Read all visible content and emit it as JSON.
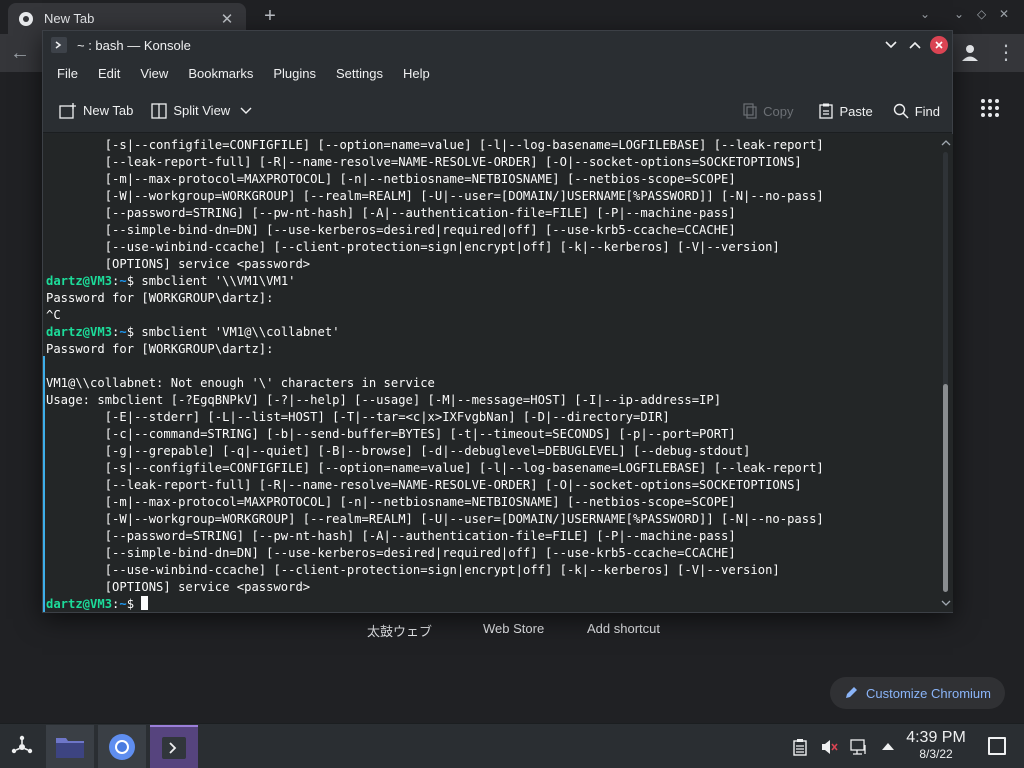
{
  "browser": {
    "tab_title": "New Tab",
    "tab_close": "✕",
    "new_tab": "+",
    "shortcuts": [
      "太鼓ウェブ",
      "Web Store",
      "Add shortcut"
    ],
    "customize_label": "Customize Chromium",
    "accent": "#8ab4f8"
  },
  "konsole": {
    "title": "~ : bash — Konsole",
    "menu": [
      "File",
      "Edit",
      "View",
      "Bookmarks",
      "Plugins",
      "Settings",
      "Help"
    ],
    "toolbar": {
      "new_tab": "New Tab",
      "split_view": "Split View",
      "copy": "Copy",
      "paste": "Paste",
      "find": "Find"
    },
    "terminal_lines": [
      {
        "text": "        [-s|--configfile=CONFIGFILE] [--option=name=value] [-l|--log-basename=LOGFILEBASE] [--leak-report]"
      },
      {
        "text": "        [--leak-report-full] [-R|--name-resolve=NAME-RESOLVE-ORDER] [-O|--socket-options=SOCKETOPTIONS]"
      },
      {
        "text": "        [-m|--max-protocol=MAXPROTOCOL] [-n|--netbiosname=NETBIOSNAME] [--netbios-scope=SCOPE]"
      },
      {
        "text": "        [-W|--workgroup=WORKGROUP] [--realm=REALM] [-U|--user=[DOMAIN/]USERNAME[%PASSWORD]] [-N|--no-pass]"
      },
      {
        "text": "        [--password=STRING] [--pw-nt-hash] [-A|--authentication-file=FILE] [-P|--machine-pass]"
      },
      {
        "text": "        [--simple-bind-dn=DN] [--use-kerberos=desired|required|off] [--use-krb5-ccache=CCACHE]"
      },
      {
        "text": "        [--use-winbind-ccache] [--client-protection=sign|encrypt|off] [-k|--kerberos] [-V|--version]"
      },
      {
        "text": "        [OPTIONS] service <password>"
      },
      {
        "user": "dartz@VM3",
        "path": "~",
        "cmd": " smbclient '\\\\VM1\\VM1'"
      },
      {
        "text": "Password for [WORKGROUP\\dartz]:"
      },
      {
        "text": "^C"
      },
      {
        "user": "dartz@VM3",
        "path": "~",
        "cmd": " smbclient 'VM1@\\\\collabnet'"
      },
      {
        "text": "Password for [WORKGROUP\\dartz]:"
      },
      {
        "text": ""
      },
      {
        "text": "VM1@\\\\collabnet: Not enough '\\' characters in service"
      },
      {
        "text": "Usage: smbclient [-?EgqBNPkV] [-?|--help] [--usage] [-M|--message=HOST] [-I|--ip-address=IP]"
      },
      {
        "text": "        [-E|--stderr] [-L|--list=HOST] [-T|--tar=<c|x>IXFvgbNan] [-D|--directory=DIR]"
      },
      {
        "text": "        [-c|--command=STRING] [-b|--send-buffer=BYTES] [-t|--timeout=SECONDS] [-p|--port=PORT]"
      },
      {
        "text": "        [-g|--grepable] [-q|--quiet] [-B|--browse] [-d|--debuglevel=DEBUGLEVEL] [--debug-stdout]"
      },
      {
        "text": "        [-s|--configfile=CONFIGFILE] [--option=name=value] [-l|--log-basename=LOGFILEBASE] [--leak-report]"
      },
      {
        "text": "        [--leak-report-full] [-R|--name-resolve=NAME-RESOLVE-ORDER] [-O|--socket-options=SOCKETOPTIONS]"
      },
      {
        "text": "        [-m|--max-protocol=MAXPROTOCOL] [-n|--netbiosname=NETBIOSNAME] [--netbios-scope=SCOPE]"
      },
      {
        "text": "        [-W|--workgroup=WORKGROUP] [--realm=REALM] [-U|--user=[DOMAIN/]USERNAME[%PASSWORD]] [-N|--no-pass]"
      },
      {
        "text": "        [--password=STRING] [--pw-nt-hash] [-A|--authentication-file=FILE] [-P|--machine-pass]"
      },
      {
        "text": "        [--simple-bind-dn=DN] [--use-kerberos=desired|required|off] [--use-krb5-ccache=CCACHE]"
      },
      {
        "text": "        [--use-winbind-ccache] [--client-protection=sign|encrypt|off] [-k|--kerberos] [-V|--version]"
      },
      {
        "text": "        [OPTIONS] service <password>"
      },
      {
        "user": "dartz@VM3",
        "path": "~",
        "cmd": " ",
        "cursor": true
      }
    ],
    "colors": {
      "prompt_user": "#1cdc9a",
      "prompt_path": "#1d99f3",
      "background": "#232627",
      "close_button": "#da4453"
    }
  },
  "taskbar": {
    "tasks": [
      "files-icon",
      "chromium-icon",
      "konsole-icon"
    ],
    "tray": [
      "clipboard-icon",
      "volume-muted-icon",
      "network-wired-icon",
      "tray-expand-icon"
    ],
    "time": "4:39 PM",
    "date": "8/3/22"
  }
}
